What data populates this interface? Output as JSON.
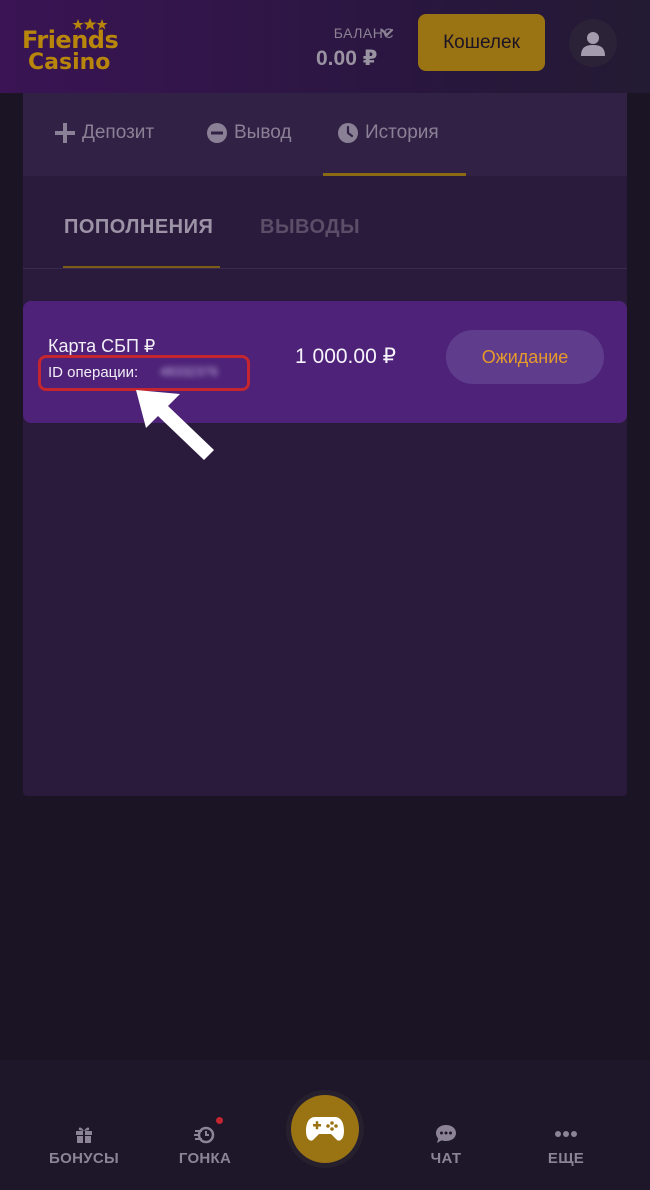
{
  "header": {
    "logo_line1": "Friends",
    "logo_line2": "Casino",
    "balance_label": "БАЛАНС",
    "balance_value": "0.00 ₽",
    "wallet_button": "Кошелек"
  },
  "tabs": [
    {
      "label": "Депозит",
      "icon": "plus-icon"
    },
    {
      "label": "Вывод",
      "icon": "minus-circle-icon"
    },
    {
      "label": "История",
      "icon": "clock-icon",
      "active": true
    }
  ],
  "subtabs": [
    {
      "label": "ПОПОЛНЕНИЯ",
      "active": true
    },
    {
      "label": "ВЫВОДЫ",
      "active": false
    }
  ],
  "transactions": [
    {
      "method": "Карта СБП ₽",
      "id_label": "ID операции:",
      "id_value": "48332376",
      "amount": "1 000.00 ₽",
      "status": "Ожидание"
    }
  ],
  "bottom_nav": [
    {
      "label": "БОНУСЫ",
      "icon": "gift-icon"
    },
    {
      "label": "ГОНКА",
      "icon": "race-icon",
      "has_notification": true
    },
    {
      "label": "",
      "icon": "gamepad-icon"
    },
    {
      "label": "ЧАТ",
      "icon": "chat-icon"
    },
    {
      "label": "ЕЩЕ",
      "icon": "more-icon"
    }
  ],
  "colors": {
    "accent_gold": "#9a7313",
    "card_purple": "#4d2278",
    "status_orange": "#e59a2a",
    "highlight_red": "#c4252f"
  }
}
